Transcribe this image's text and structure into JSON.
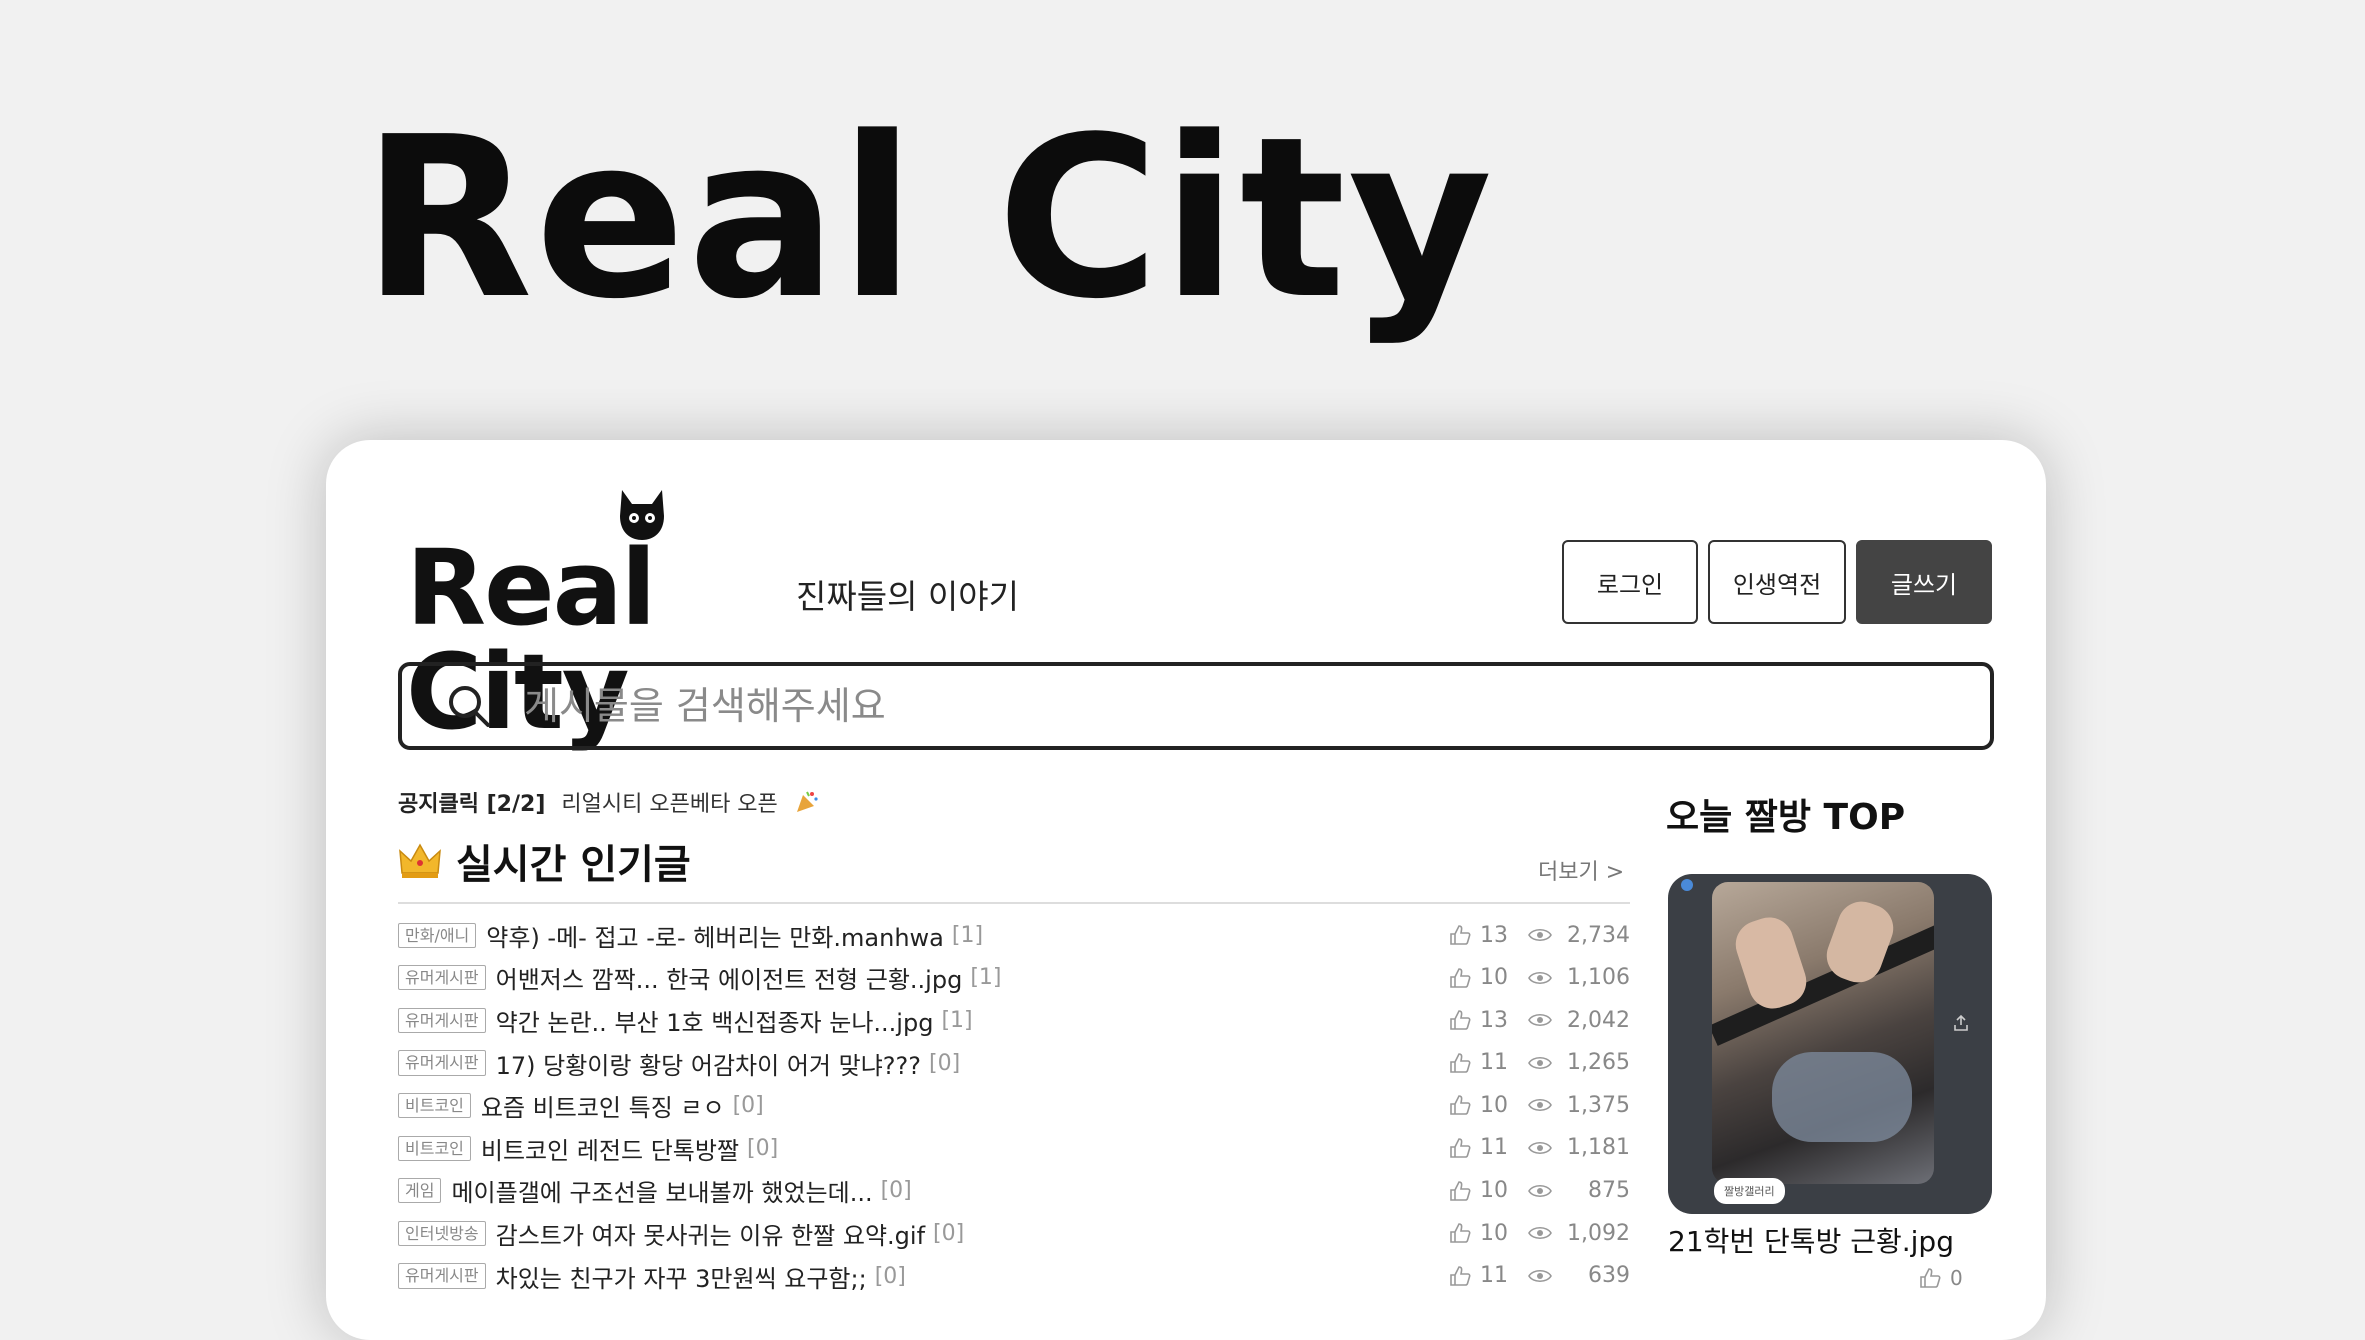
{
  "hero": {
    "title": "Real City"
  },
  "header": {
    "logo_text": "Real City",
    "tagline": "진짜들의 이야기",
    "buttons": {
      "login": "로그인",
      "life": "인생역전",
      "write": "글쓰기"
    }
  },
  "search": {
    "placeholder": "게시물을 검색해주세요"
  },
  "notice": {
    "label": "공지클릭 [2/2]",
    "text": "리얼시티 오픈베타 오픈"
  },
  "popular": {
    "title": "실시간 인기글",
    "more": "더보기 >",
    "posts": [
      {
        "category": "만화/애니",
        "title": "약후) -메- 접고 -로- 헤버리는 만화.manhwa",
        "comments": "[1]",
        "likes": "13",
        "views": "2,734"
      },
      {
        "category": "유머게시판",
        "title": "어밴저스 깜짝... 한국 에이전트 전형 근황..jpg",
        "comments": "[1]",
        "likes": "10",
        "views": "1,106"
      },
      {
        "category": "유머게시판",
        "title": "약간 논란.. 부산 1호 백신접종자 눈나...jpg",
        "comments": "[1]",
        "likes": "13",
        "views": "2,042"
      },
      {
        "category": "유머게시판",
        "title": "17) 당황이랑 황당 어감차이 어거 맞냐???",
        "comments": "[0]",
        "likes": "11",
        "views": "1,265"
      },
      {
        "category": "비트코인",
        "title": "요즘 비트코인 특징 ㄹㅇ",
        "comments": "[0]",
        "likes": "10",
        "views": "1,375"
      },
      {
        "category": "비트코인",
        "title": "비트코인 레전드 단톡방짤",
        "comments": "[0]",
        "likes": "11",
        "views": "1,181"
      },
      {
        "category": "게임",
        "title": "메이플갤에 구조선을 보내볼까 했었는데...",
        "comments": "[0]",
        "likes": "10",
        "views": "875"
      },
      {
        "category": "인터넷방송",
        "title": "감스트가 여자 못사귀는 이유 한짤 요약.gif",
        "comments": "[0]",
        "likes": "10",
        "views": "1,092"
      },
      {
        "category": "유머게시판",
        "title": "차있는 친구가 자꾸 3만원씩 요구함;;",
        "comments": "[0]",
        "likes": "11",
        "views": "639"
      }
    ]
  },
  "sidebar": {
    "title": "오늘 짤방 TOP",
    "badge": "짤방갤러리",
    "caption": "21학번 단톡방 근황.jpg",
    "likes": "0"
  },
  "icons": [
    "cat-icon",
    "search-icon",
    "party-icon",
    "crown-icon",
    "thumb-up-icon",
    "eye-icon",
    "share-icon"
  ]
}
